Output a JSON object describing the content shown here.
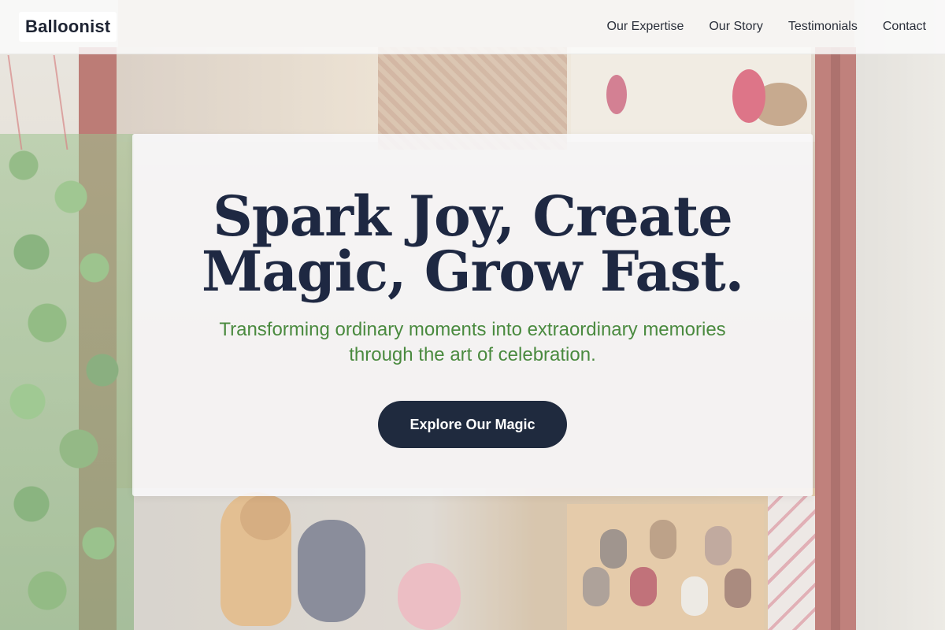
{
  "header": {
    "logo": "Balloonist",
    "nav": [
      {
        "label": "Our Expertise"
      },
      {
        "label": "Our Story"
      },
      {
        "label": "Testimonials"
      },
      {
        "label": "Contact"
      }
    ]
  },
  "hero": {
    "title_line1": "Spark Joy, Create",
    "title_line2": "Magic, Grow Fast.",
    "subtitle": "Transforming ordinary moments into extraordinary memories through the art of celebration.",
    "cta_label": "Explore Our Magic"
  },
  "colors": {
    "navy": "#1e2842",
    "accent_green": "#4a8a3f",
    "button": "#1f2a3e"
  }
}
